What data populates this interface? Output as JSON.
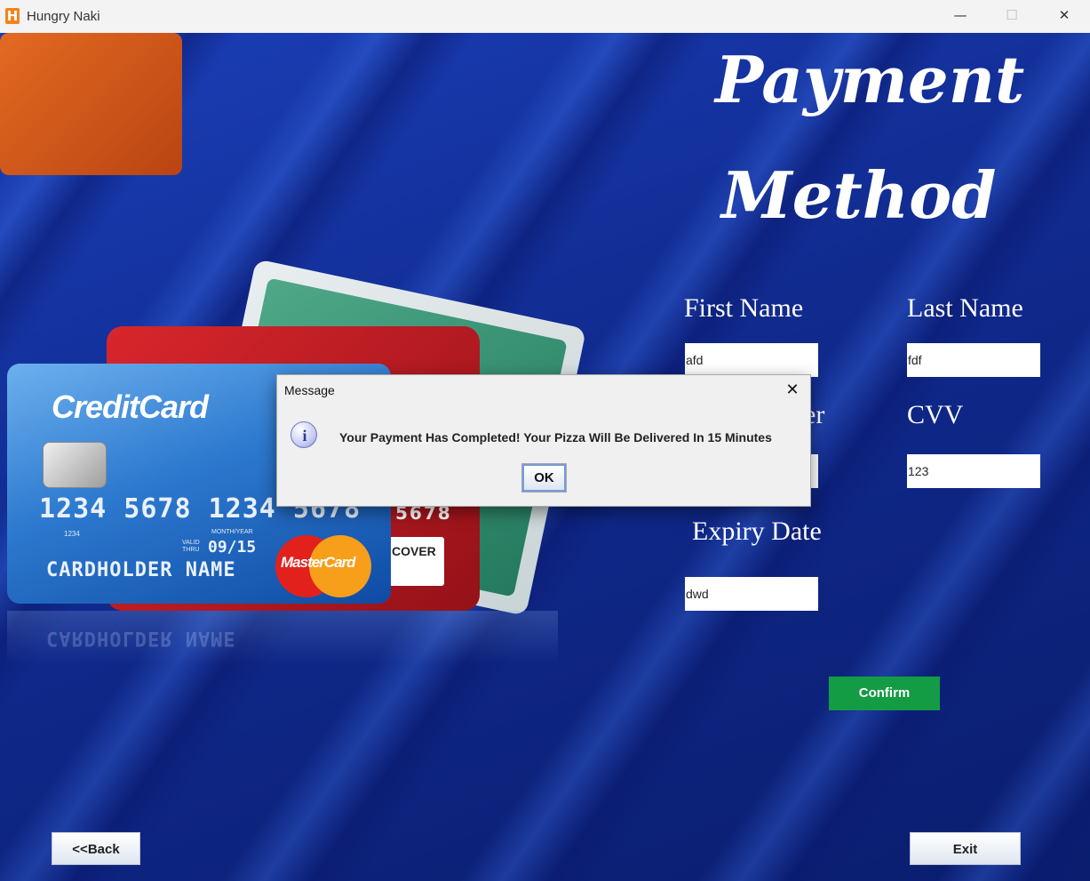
{
  "window": {
    "app_icon_letter": "H",
    "title": "Hungry Naki",
    "minimize": "—",
    "maximize": "☐",
    "close": "✕"
  },
  "page": {
    "heading_line1": "Payment",
    "heading_line2": "Method"
  },
  "form": {
    "first_name_label": "First Name",
    "first_name_value": "afd",
    "last_name_label": "Last Name",
    "last_name_value": "fdf",
    "card_number_label_visible": "er",
    "card_number_value": "",
    "cvv_label": "CVV",
    "cvv_value": "123",
    "expiry_label": "Expiry Date",
    "expiry_value": "dwd",
    "confirm_label": "Confirm"
  },
  "nav": {
    "back_label": "<<Back",
    "exit_label": "Exit"
  },
  "illustration": {
    "brand": "CreditCard",
    "number": "1234 5678 1234 5678",
    "small_number": "1234",
    "valid_thru": "VALID\nTHRU",
    "month_year": "MONTH/YEAR",
    "expiry": "09/15",
    "holder": "CARDHOLDER NAME",
    "mastercard": "MasterCard",
    "orange_digits": "5678",
    "discover": "COVER"
  },
  "dialog": {
    "title": "Message",
    "close": "✕",
    "icon": "info-icon",
    "icon_glyph": "i",
    "message": "Your Payment Has Completed! Your Pizza Will Be Delivered In 15 Minutes",
    "ok_label": "OK"
  }
}
